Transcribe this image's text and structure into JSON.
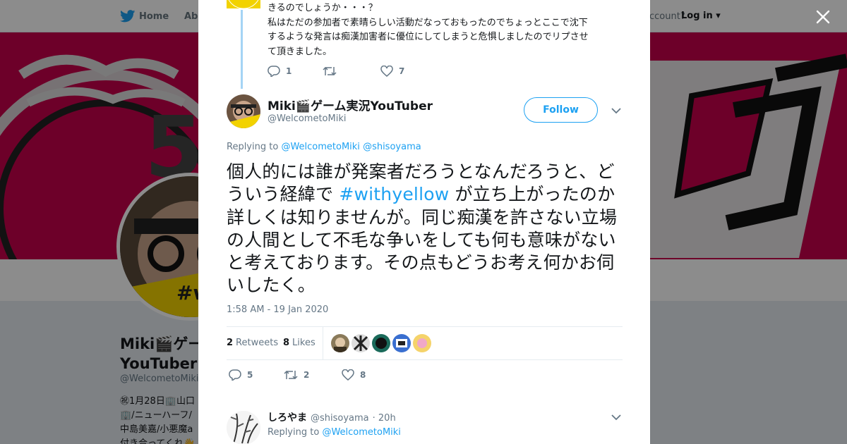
{
  "nav": {
    "home_label": "Home",
    "about_label": "Abo",
    "account_text": "ccount?",
    "login_label": "Log in"
  },
  "background_profile": {
    "name": "Miki🎬ゲー\nYouTuber",
    "handle": "@WelcometoMiki",
    "bio": "㊗1月28日🏢山口\n🏢/ニューハーフ/\n中島美嘉/小悪魔a\n付き合ってくれ👋"
  },
  "previous_tweet": {
    "text": "きるのでしょうか・・・？\n私はただの参加者で素晴らしい活動だなっておもったのでちょっとここで沈下\nするような発言は痴漢加害者に優位にしてしまうと危惧しましたのでリプさせ\nて頂きました。",
    "reply_count": "1",
    "retweet_count": "",
    "like_count": "7"
  },
  "tweet": {
    "author_name": "Miki🎬ゲーム実況YouTuber",
    "author_handle": "@WelcometoMiki",
    "follow_label": "Follow",
    "replying_prefix": "Replying to",
    "replying_to_1": "@WelcometoMiki",
    "replying_to_2": "@shisoyama",
    "text_part1": "個人的には誰が発案者だろうとなんだろうと、どういう経緯で ",
    "hashtag": "#withyellow",
    "text_part2": " が立ち上がったのか詳しくは知りませんが。同じ痴漢を許さない立場の人間として不毛な争いをしても何も意味がないと考えております。その点もどうお考え何かお伺いしたく。",
    "timestamp": "1:58 AM - 19 Jan 2020",
    "retweets_count": "2",
    "retweets_label": "Retweets",
    "likes_count": "8",
    "likes_label": "Likes",
    "reply_count": "5",
    "retweet_count": "2",
    "like_count": "8"
  },
  "next_reply": {
    "author_name": "しろやま",
    "author_handle": "@shisoyama",
    "time": "· 20h",
    "replying_prefix": "Replying to",
    "replying_to": "@WelcometoMiki"
  },
  "colors": {
    "accent": "#1da1f2",
    "banner": "#c7004c",
    "thread_line": "#a5d4f5"
  }
}
